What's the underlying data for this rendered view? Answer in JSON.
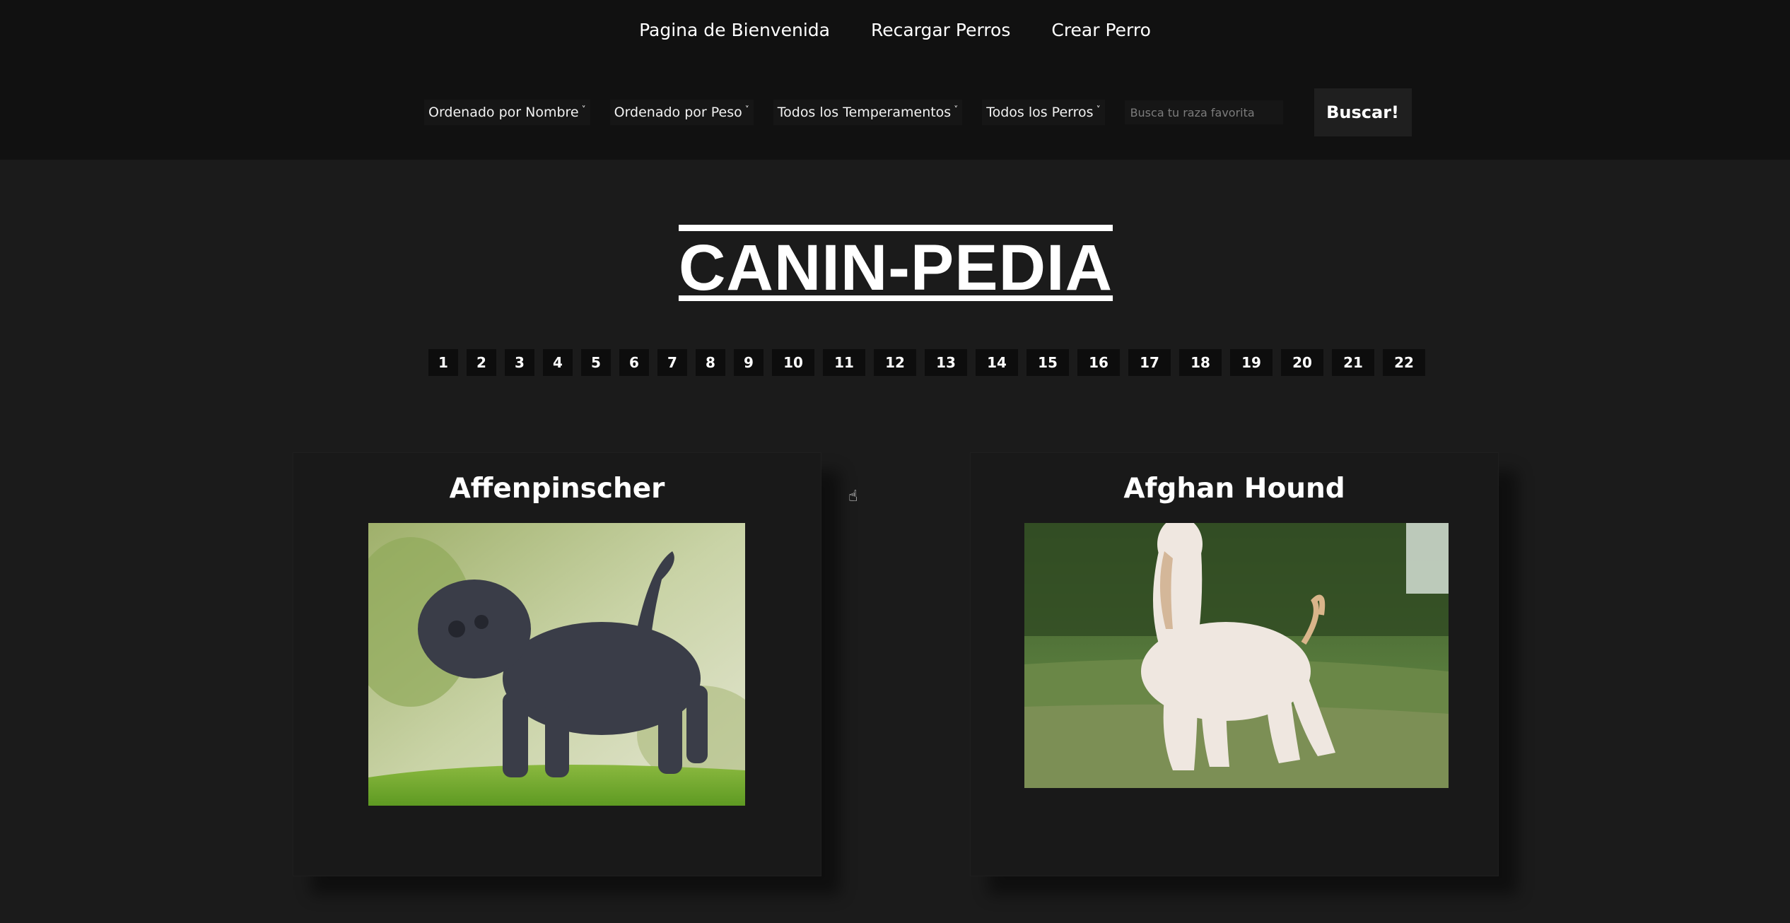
{
  "nav": {
    "items": [
      {
        "label": "Pagina de Bienvenida"
      },
      {
        "label": "Recargar Perros"
      },
      {
        "label": "Crear Perro"
      }
    ]
  },
  "filters": {
    "sort_name": "Ordenado por Nombre",
    "sort_weight": "Ordenado por Peso",
    "temperaments": "Todos los Temperamentos",
    "dogs": "Todos los Perros",
    "search_placeholder": "Busca tu raza favorita",
    "search_button": "Buscar!"
  },
  "title": "CANIN-PEDIA",
  "pagination": [
    "1",
    "2",
    "3",
    "4",
    "5",
    "6",
    "7",
    "8",
    "9",
    "10",
    "11",
    "12",
    "13",
    "14",
    "15",
    "16",
    "17",
    "18",
    "19",
    "20",
    "21",
    "22"
  ],
  "cards": [
    {
      "name": "Affenpinscher"
    },
    {
      "name": "Afghan Hound"
    }
  ],
  "icons": {
    "dropdown": "chevron-down-icon",
    "cursor": "hand-pointer-icon"
  }
}
